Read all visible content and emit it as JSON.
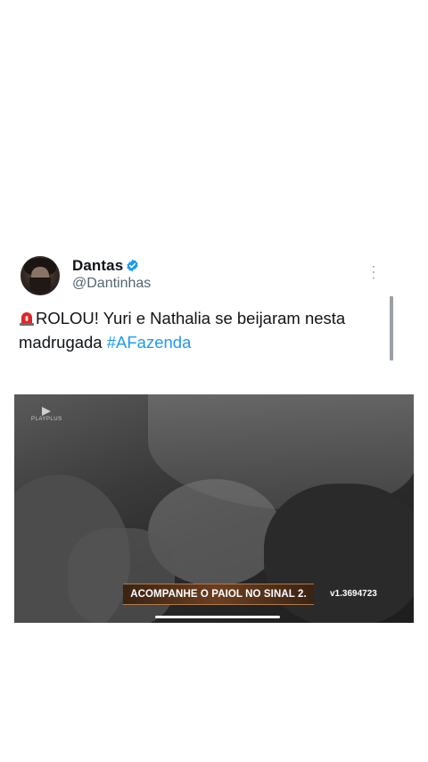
{
  "tweet": {
    "name": "Dantas",
    "handle": "@Dantinhas",
    "text_main": "ROLOU! Yuri e Nathalia se beijaram nesta madrugada ",
    "hashtag": "#AFazenda"
  },
  "video": {
    "logo_text": "PLAYPLUS",
    "banner_text": "ACOMPANHE O PAIOL NO SINAL 2.",
    "version": "v1.3694723"
  },
  "colors": {
    "link": "#1d9bf0",
    "verified": "#1d9bf0",
    "banner": "#6a3f21"
  }
}
